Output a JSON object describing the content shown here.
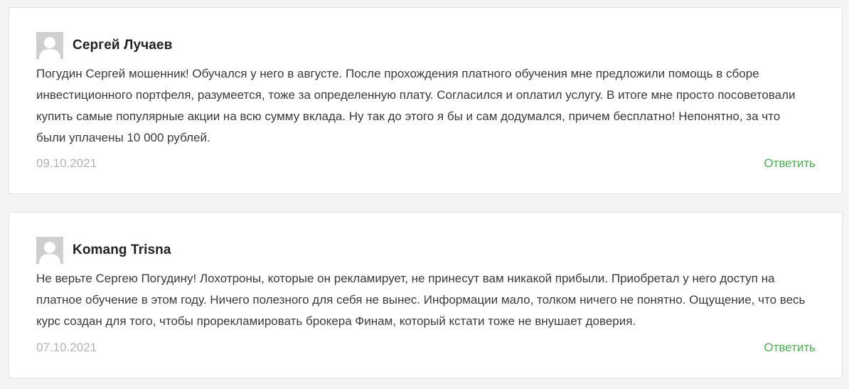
{
  "comments": [
    {
      "author": "Сергей Лучаев",
      "avatar_icon": "default-avatar-icon",
      "text": "Погудин Сергей мошенник! Обучался у него в августе. После прохождения платного обучения мне предложили помощь в сборе инвестиционного портфеля, разумеется, тоже за определенную плату. Согласился и оплатил услугу. В итоге мне просто посоветовали купить самые популярные акции на всю сумму вклада. Ну так до этого я бы и сам додумался, причем бесплатно! Непонятно, за что были уплачены 10 000 рублей.",
      "date": "09.10.2021",
      "reply_label": "Ответить"
    },
    {
      "author": "Komang Trisna",
      "avatar_icon": "default-avatar-icon",
      "text": "Не верьте Сергею Погудину! Лохотроны, которые он рекламирует, не принесут вам никакой прибыли. Приобретал у него доступ на платное обучение в этом году. Ничего полезного для себя не вынес. Информации мало, толком ничего не понятно. Ощущение, что весь курс создан для того, чтобы прорекламировать брокера Финам, который кстати тоже не внушает доверия.",
      "date": "07.10.2021",
      "reply_label": "Ответить"
    }
  ],
  "colors": {
    "accent": "#4caf50",
    "date": "#b3b3b3",
    "text": "#3a3a3a",
    "author": "#222222",
    "avatar_bg": "#cfcfcf"
  }
}
